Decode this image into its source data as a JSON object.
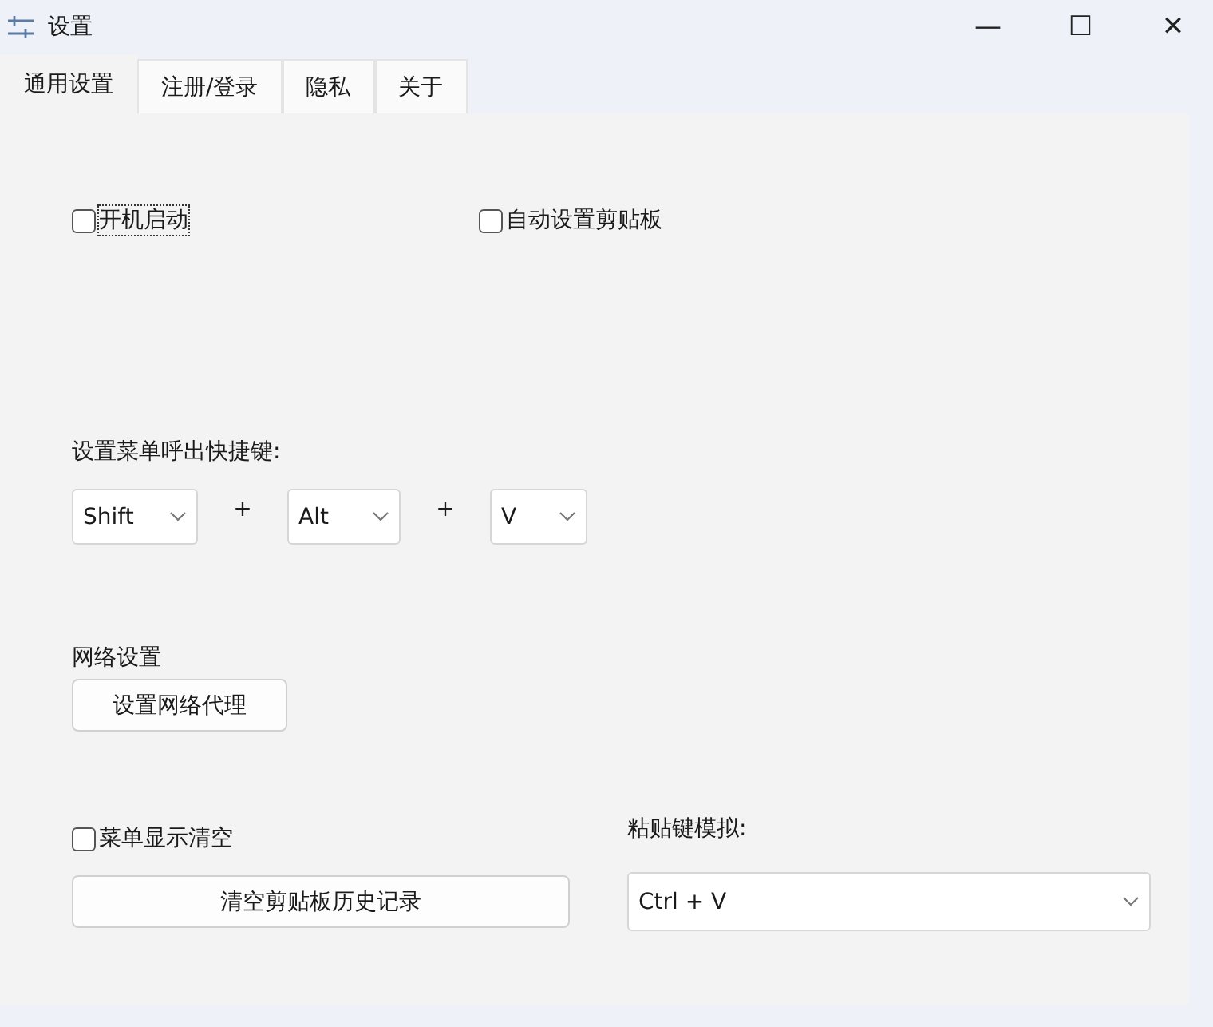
{
  "window": {
    "title": "设置",
    "controls": [
      "—",
      "☐",
      "✕"
    ]
  },
  "tabs": [
    {
      "label": "通用设置",
      "selected": true
    },
    {
      "label": "注册/登录",
      "selected": false
    },
    {
      "label": "隐私",
      "selected": false
    },
    {
      "label": "关于",
      "selected": false
    }
  ],
  "checkboxes": [
    {
      "label": "开机启动",
      "checked": false,
      "focused": true
    },
    {
      "label": "自动设置剪贴板",
      "checked": false,
      "focused": false
    }
  ],
  "hotkey": {
    "label": "设置菜单呼出快捷键:",
    "keys": [
      "Shift",
      "Alt",
      "V"
    ],
    "joiner": "+"
  },
  "network": {
    "label": "网络设置",
    "button": "设置网络代理"
  },
  "menu_clear": {
    "label": "菜单显示清空",
    "checked": false
  },
  "clear_button": "清空剪贴板历史记录",
  "paste": {
    "label": "粘贴键模拟:",
    "value": "Ctrl + V"
  }
}
